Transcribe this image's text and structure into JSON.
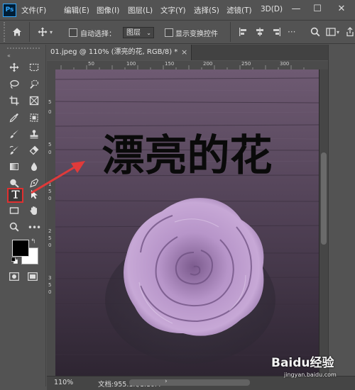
{
  "app": {
    "logo": "Ps"
  },
  "menu": [
    "文件(F)",
    "编辑(E)",
    "图像(I)",
    "图层(L)",
    "文字(Y)",
    "选择(S)",
    "滤镜(T)",
    "3D(D)"
  ],
  "window_buttons": {
    "minimize": "—",
    "maximize": "☐",
    "close": "✕"
  },
  "options": {
    "auto_select_label": "自动选择：",
    "layer_value": "图层",
    "show_transform_label": "显示变换控件"
  },
  "document": {
    "tab_title": "01.jpeg @ 110% (漂亮的花, RGB/8) *",
    "tab_close": "×",
    "headline": "漂亮的花",
    "zoom": "110%",
    "doc_info": "文档:955.1K/1.10M"
  },
  "rulers": {
    "top": [
      "50",
      "100",
      "150",
      "200",
      "250",
      "300"
    ],
    "left": [
      "5",
      "0",
      "5",
      "0",
      "1",
      "5",
      "0",
      "2",
      "5",
      "0",
      "3",
      "5",
      "0"
    ]
  },
  "watermark": {
    "brand": "Baidu经验",
    "url": "jingyan.baidu.com"
  },
  "colors": {
    "ui_bg": "#535353",
    "highlight": "#e03030",
    "arrow": "#e03a3a",
    "wood_top": "#6c5870",
    "rose": "#b391c4"
  },
  "tools": [
    "move-tool",
    "marquee-tool",
    "lasso-tool",
    "quick-select-tool",
    "crop-tool",
    "frame-tool",
    "eyedropper-tool",
    "heal-tool",
    "brush-tool",
    "stamp-tool",
    "history-brush-tool",
    "eraser-tool",
    "gradient-tool",
    "blur-tool",
    "dodge-tool",
    "pen-tool",
    "type-tool",
    "path-select-tool",
    "rectangle-tool",
    "hand-tool",
    "zoom-tool",
    "more-tools",
    "foreground-color",
    "background-color",
    "quick-mask",
    "screen-mode"
  ]
}
